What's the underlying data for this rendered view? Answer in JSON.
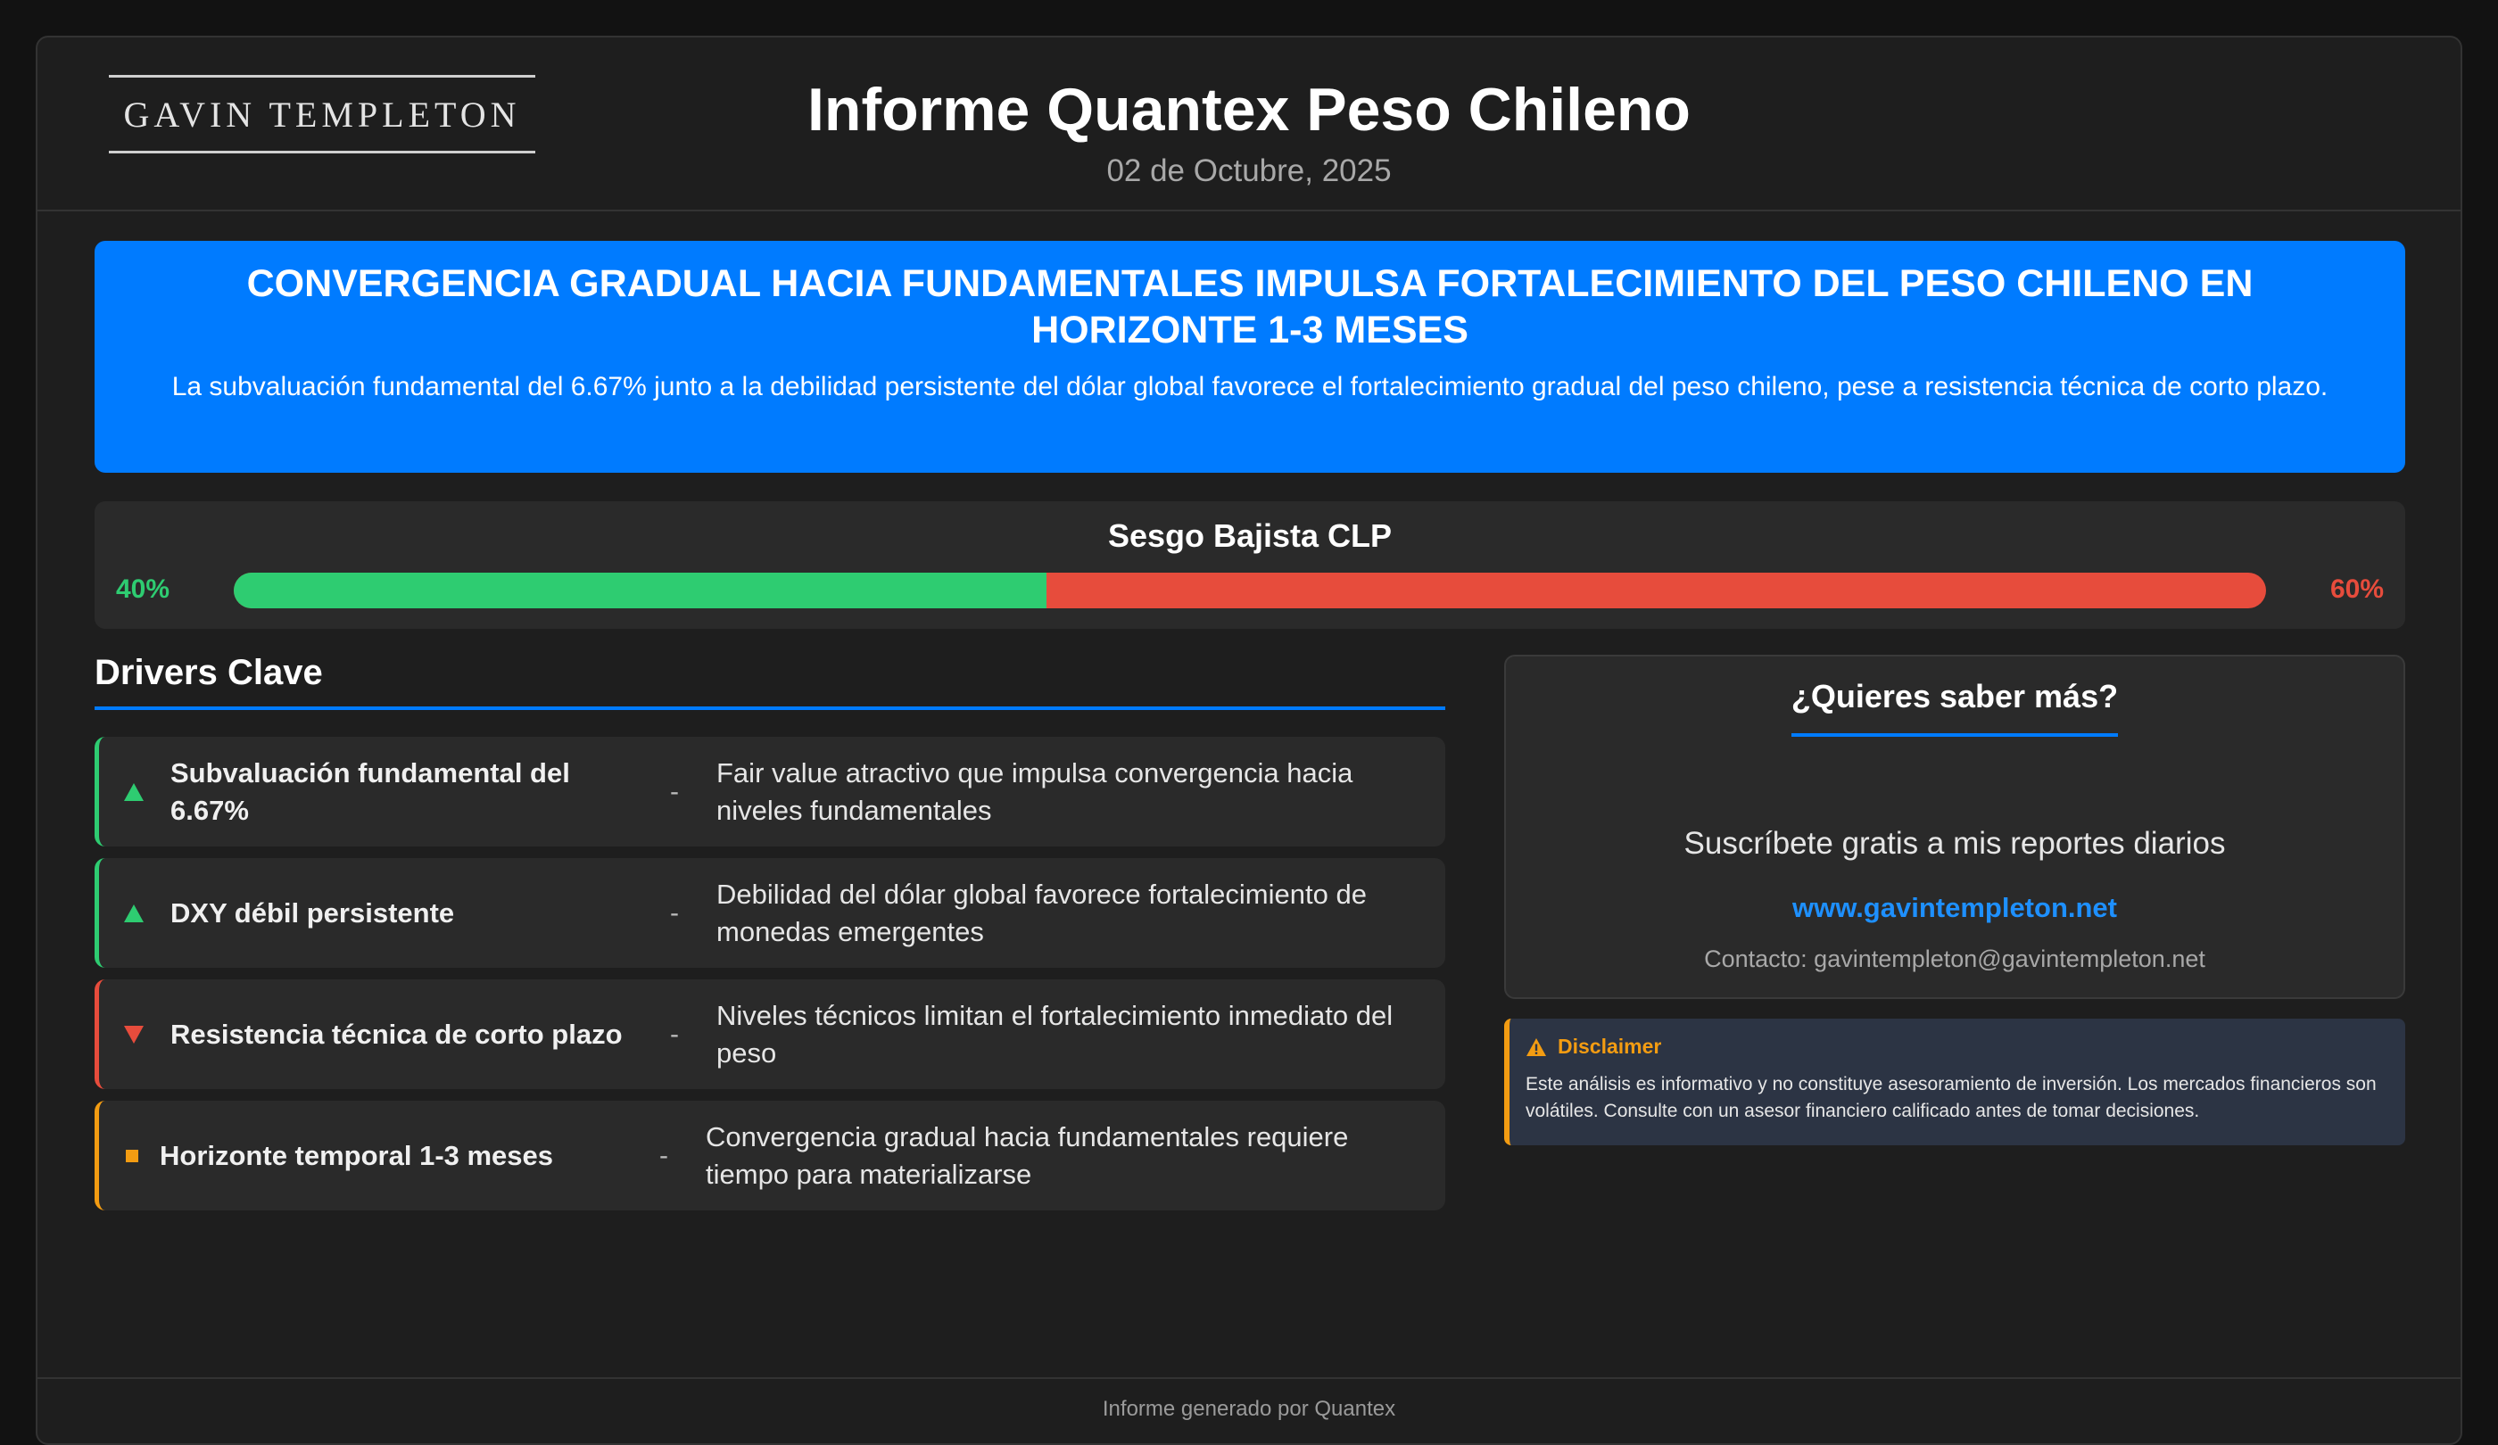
{
  "header": {
    "logo": "GAVIN TEMPLETON",
    "title": "Informe Quantex Peso Chileno",
    "date": "02 de Octubre, 2025"
  },
  "banner": {
    "title": "CONVERGENCIA GRADUAL HACIA FUNDAMENTALES IMPULSA FORTALECIMIENTO DEL PESO CHILENO EN HORIZONTE 1-3 MESES",
    "text": "La subvaluación fundamental del 6.67% junto a la debilidad persistente del dólar global favorece el fortalecimiento gradual del peso chileno, pese a resistencia técnica de corto plazo."
  },
  "bias": {
    "title": "Sesgo Bajista CLP",
    "left_label": "40%",
    "right_label": "60%",
    "left_value": 40,
    "right_value": 60,
    "left_color": "#2ecc71",
    "right_color": "#e74c3c"
  },
  "drivers": {
    "title": "Drivers Clave",
    "separator": "-",
    "items": [
      {
        "icon": "arrow-up-icon",
        "direction": "up",
        "name": "Subvaluación fundamental del 6.67%",
        "description": "Fair value atractivo que impulsa convergencia hacia niveles fundamentales"
      },
      {
        "icon": "arrow-up-icon",
        "direction": "up",
        "name": "DXY débil persistente",
        "description": "Debilidad del dólar global favorece fortalecimiento de monedas emergentes"
      },
      {
        "icon": "arrow-down-icon",
        "direction": "down",
        "name": "Resistencia técnica de corto plazo",
        "description": "Niveles técnicos limitan el fortalecimiento inmediato del peso"
      },
      {
        "icon": "square-icon",
        "direction": "neutral",
        "name": "Horizonte temporal 1-3 meses",
        "description": "Convergencia gradual hacia fundamentales requiere tiempo para materializarse"
      }
    ]
  },
  "subscribe": {
    "title": "¿Quieres saber más?",
    "text": "Suscríbete gratis a mis reportes diarios",
    "link": "www.gavintempleton.net",
    "contact": "Contacto: gavintempleton@gavintempleton.net"
  },
  "disclaimer": {
    "icon": "warning-icon",
    "title": "Disclaimer",
    "text": "Este análisis es informativo y no constituye asesoramiento de inversión. Los mercados financieros son volátiles. Consulte con un asesor financiero calificado antes de tomar decisiones."
  },
  "footer": {
    "text": "Informe generado por Quantex"
  },
  "colors": {
    "accent": "#007bff",
    "positive": "#2ecc71",
    "negative": "#e74c3c",
    "neutral": "#f39c12"
  }
}
